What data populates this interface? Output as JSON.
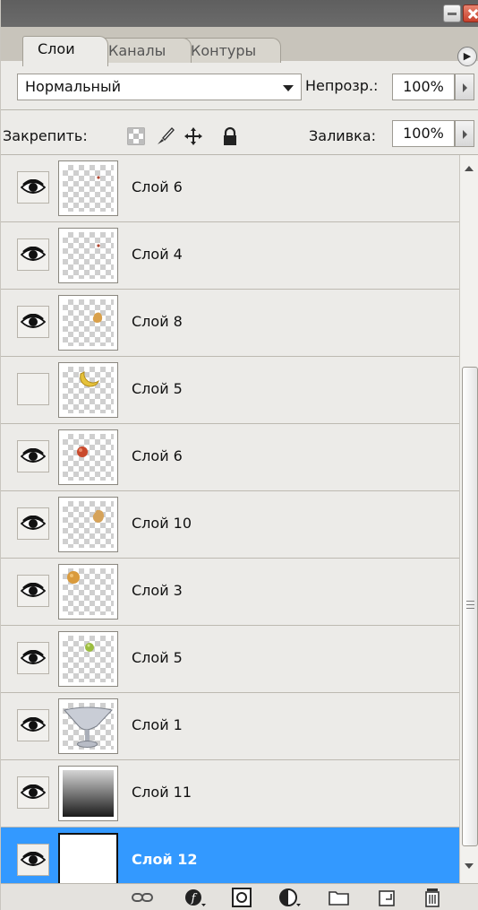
{
  "tabs": [
    {
      "label": "Слои",
      "active": true
    },
    {
      "label": "Каналы",
      "active": false
    },
    {
      "label": "Контуры",
      "active": false
    }
  ],
  "blend_mode": "Нормальный",
  "opacity": {
    "label": "Непрозр.:",
    "value": "100%"
  },
  "lock": {
    "label": "Закрепить:"
  },
  "fill": {
    "label": "Заливка:",
    "value": "100%"
  },
  "layers": [
    {
      "name": "Слой 6",
      "visible": true,
      "thumb": "tiny-red-dot",
      "selected": false
    },
    {
      "name": "Слой 4",
      "visible": true,
      "thumb": "tiny-red-dot",
      "selected": false
    },
    {
      "name": "Слой 8",
      "visible": true,
      "thumb": "orange-blob",
      "selected": false
    },
    {
      "name": "Слой 5",
      "visible": false,
      "thumb": "banana",
      "selected": false
    },
    {
      "name": "Слой 6",
      "visible": true,
      "thumb": "red-apple",
      "selected": false
    },
    {
      "name": "Слой 10",
      "visible": true,
      "thumb": "orange-blob",
      "selected": false
    },
    {
      "name": "Слой 3",
      "visible": true,
      "thumb": "orange-fruit",
      "selected": false
    },
    {
      "name": "Слой 5",
      "visible": true,
      "thumb": "green-fruit",
      "selected": false
    },
    {
      "name": "Слой 1",
      "visible": true,
      "thumb": "glass-vase",
      "selected": false
    },
    {
      "name": "Слой 11",
      "visible": true,
      "thumb": "gray-gradient",
      "selected": false
    },
    {
      "name": "Слой 12",
      "visible": true,
      "thumb": "white",
      "selected": true
    }
  ],
  "colors": {
    "selection": "#3399ff",
    "panel": "#ecebe8"
  }
}
